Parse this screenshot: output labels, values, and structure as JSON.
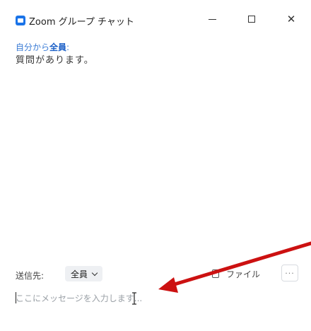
{
  "window": {
    "title": "Zoom グループ チャット",
    "minimize_glyph": "—",
    "close_glyph": "✕"
  },
  "messages": [
    {
      "from": "自分から",
      "to": "全員",
      "suffix": ":",
      "body": "質問があります。"
    }
  ],
  "toolbar": {
    "to_label": "送信先:",
    "recipient_value": "全員",
    "file_label": "ファイル",
    "more_label": "···"
  },
  "composer": {
    "placeholder": "ここにメッセージを入力します..."
  },
  "colors": {
    "annotation_arrow": "#cc1111",
    "accent": "#1a73e8"
  }
}
